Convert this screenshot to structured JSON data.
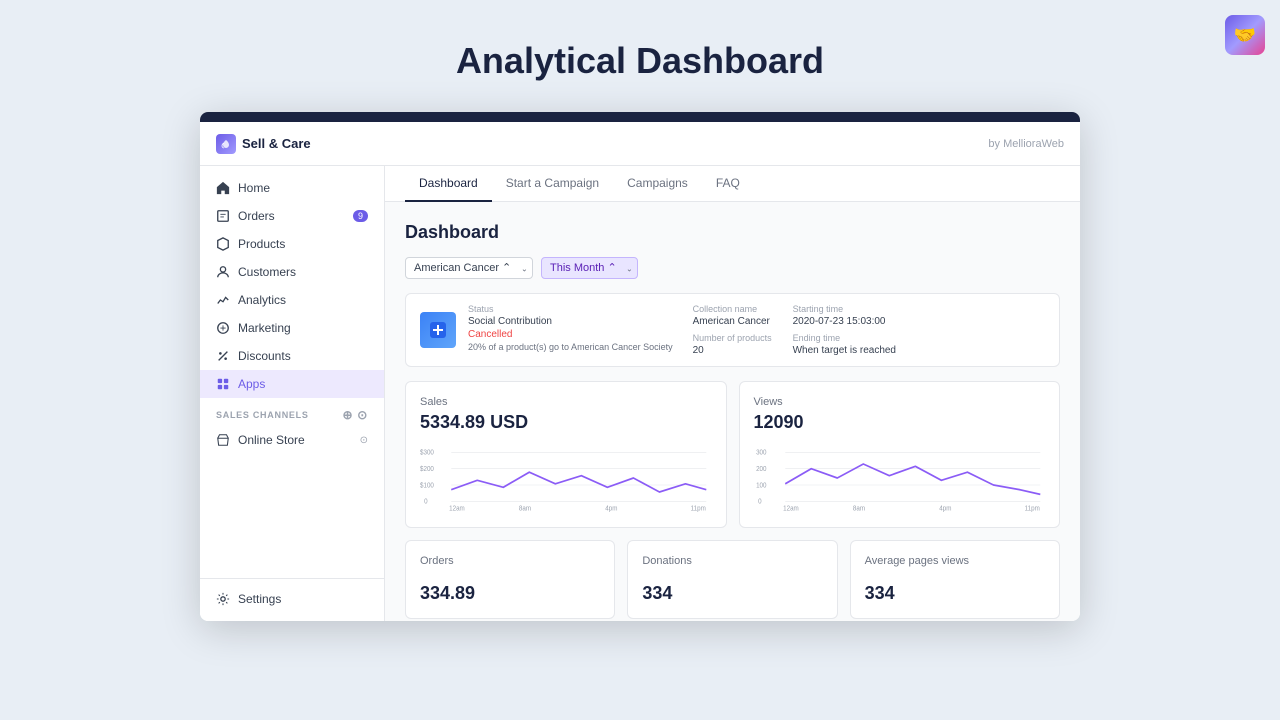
{
  "page": {
    "title": "Analytical Dashboard"
  },
  "topright": {
    "icon": "🤝"
  },
  "app": {
    "logo": "Sell & Care",
    "by": "by MellioraWeb",
    "topbar_color": "#1a2340"
  },
  "nav": {
    "tabs": [
      {
        "label": "Dashboard",
        "active": true
      },
      {
        "label": "Start a Campaign",
        "active": false
      },
      {
        "label": "Campaigns",
        "active": false
      },
      {
        "label": "FAQ",
        "active": false
      }
    ]
  },
  "sidebar": {
    "items": [
      {
        "label": "Home",
        "icon": "home",
        "active": false
      },
      {
        "label": "Orders",
        "icon": "orders",
        "active": false,
        "badge": "9"
      },
      {
        "label": "Products",
        "icon": "products",
        "active": false
      },
      {
        "label": "Customers",
        "icon": "customers",
        "active": false
      },
      {
        "label": "Analytics",
        "icon": "analytics",
        "active": false
      },
      {
        "label": "Marketing",
        "icon": "marketing",
        "active": false
      },
      {
        "label": "Discounts",
        "icon": "discounts",
        "active": false
      },
      {
        "label": "Apps",
        "icon": "apps",
        "active": true
      }
    ],
    "section_label": "SALES CHANNELS",
    "section_items": [
      {
        "label": "Online Store",
        "icon": "store"
      }
    ],
    "footer_item": {
      "label": "Settings"
    }
  },
  "dashboard": {
    "title": "Dashboard",
    "filters": {
      "campaign": "American Cancer",
      "period": "This Month"
    },
    "campaign_card": {
      "status_label": "Status",
      "status_name": "Social Contribution",
      "status_value": "Cancelled",
      "status_desc": "20% of a product(s) go to American Cancer Society",
      "collection_label": "Collection name",
      "collection_value": "American Cancer",
      "number_label": "Number of products",
      "number_value": "20",
      "start_label": "Starting time",
      "start_value": "2020-07-23 15:03:00",
      "end_label": "Ending time",
      "end_value": "When target is reached"
    },
    "sales_card": {
      "label": "Sales",
      "value": "5334.89 USD",
      "chart_y_labels": [
        "$300",
        "$200",
        "$100",
        "0"
      ],
      "chart_x_labels": [
        "12am",
        "8am",
        "4pm",
        "11pm"
      ]
    },
    "views_card": {
      "label": "Views",
      "value": "12090",
      "chart_y_labels": [
        "300",
        "200",
        "100",
        "0"
      ],
      "chart_x_labels": [
        "12am",
        "8am",
        "4pm",
        "11pm"
      ]
    },
    "orders_card": {
      "label": "Orders",
      "value": "334.89"
    },
    "donations_card": {
      "label": "Donations",
      "value": "334"
    },
    "avg_pages_card": {
      "label": "Average pages views",
      "value": "334"
    }
  }
}
